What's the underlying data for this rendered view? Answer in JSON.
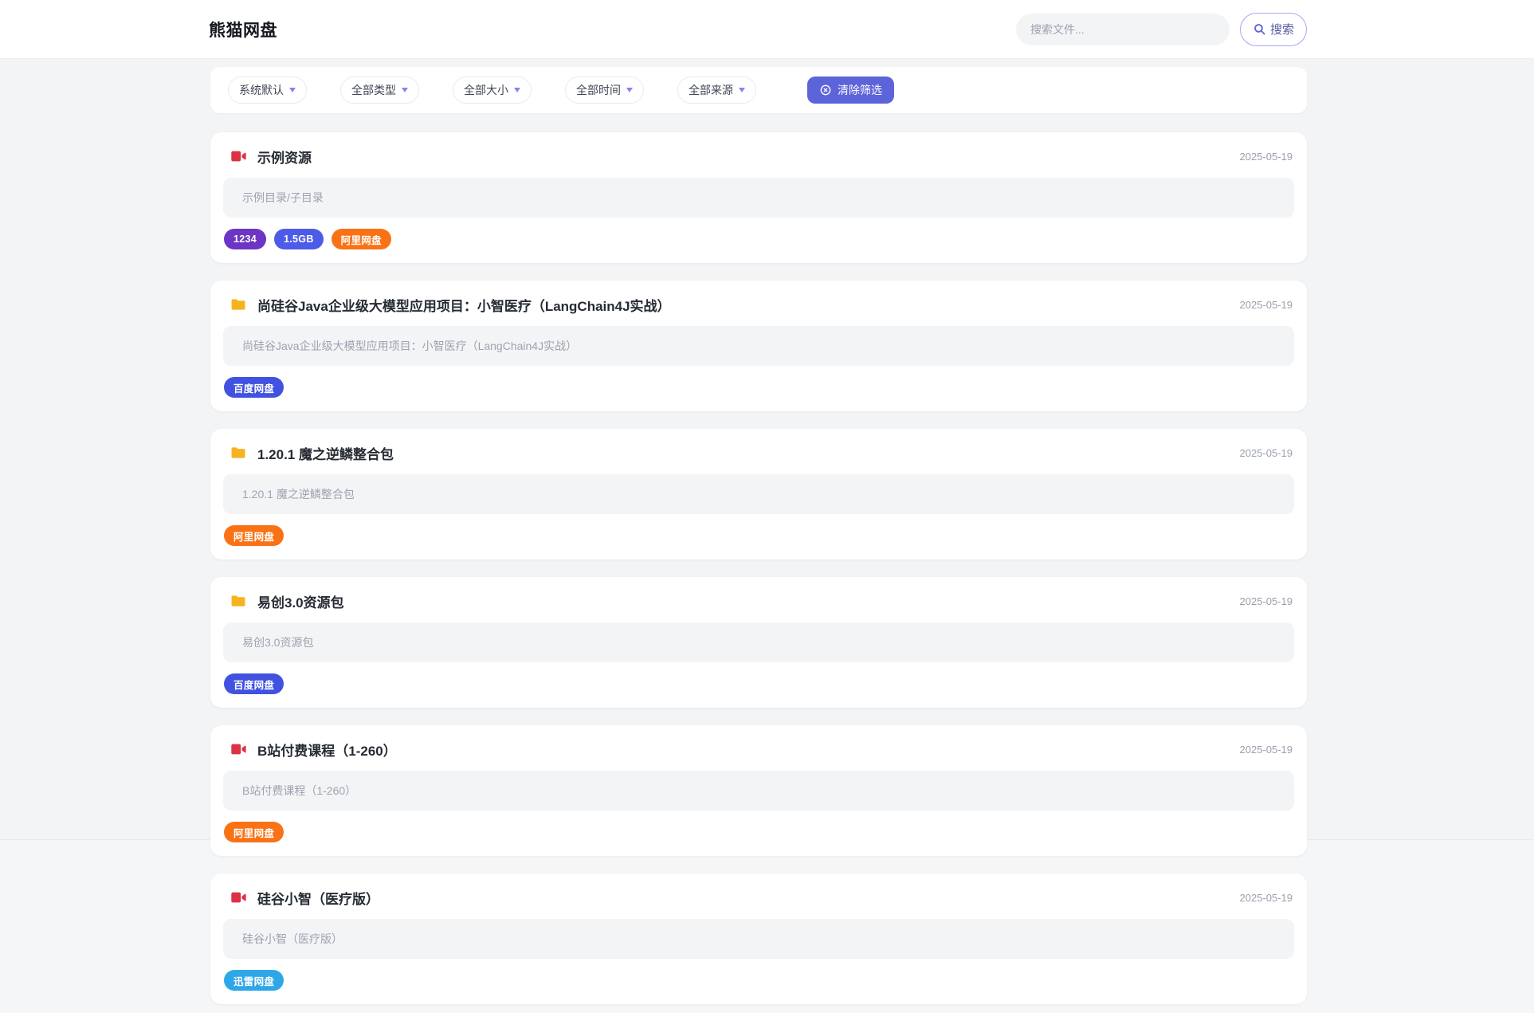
{
  "header": {
    "site_title": "熊猫网盘",
    "search": {
      "placeholder": "搜索文件...",
      "button_label": "搜索",
      "icon": "search-icon"
    }
  },
  "filters": {
    "dropdowns": [
      {
        "label": "系统默认",
        "icon": "chevron-down-icon"
      },
      {
        "label": "全部类型",
        "icon": "chevron-down-icon"
      },
      {
        "label": "全部大小",
        "icon": "chevron-down-icon"
      },
      {
        "label": "全部时间",
        "icon": "chevron-down-icon"
      },
      {
        "label": "全部来源",
        "icon": "chevron-down-icon"
      }
    ],
    "clear_button": {
      "label": "清除筛选",
      "icon": "circle-x-icon",
      "bg_color": "#5d63d9"
    }
  },
  "results": [
    {
      "icon": "video",
      "title": "示例资源",
      "date": "2025-05-19",
      "description": "示例目录/子目录",
      "tags": [
        {
          "label": "1234",
          "color": "#6d35c4"
        },
        {
          "label": "1.5GB",
          "color": "#4d5ce8"
        },
        {
          "label": "阿里网盘",
          "color": "#f97316"
        }
      ]
    },
    {
      "icon": "folder",
      "title": "尚硅谷Java企业级大模型应用项目：小智医疗（LangChain4J实战）",
      "date": "2025-05-19",
      "description": "尚硅谷Java企业级大模型应用项目：小智医疗（LangChain4J实战）",
      "tags": [
        {
          "label": "百度网盘",
          "color": "#4152e0"
        }
      ]
    },
    {
      "icon": "folder",
      "title": "1.20.1 魔之逆鳞整合包",
      "date": "2025-05-19",
      "description": "1.20.1 魔之逆鳞整合包",
      "tags": [
        {
          "label": "阿里网盘",
          "color": "#f97316"
        }
      ]
    },
    {
      "icon": "folder",
      "title": "易创3.0资源包",
      "date": "2025-05-19",
      "description": "易创3.0资源包",
      "tags": [
        {
          "label": "百度网盘",
          "color": "#4152e0"
        }
      ]
    },
    {
      "icon": "video",
      "title": "B站付费课程（1-260）",
      "date": "2025-05-19",
      "description": "B站付费课程（1-260）",
      "tags": [
        {
          "label": "阿里网盘",
          "color": "#f97316"
        }
      ]
    },
    {
      "icon": "video",
      "title": "硅谷小智（医疗版）",
      "date": "2025-05-19",
      "description": "硅谷小智（医疗版）",
      "tags": [
        {
          "label": "迅雷网盘",
          "color": "#2ea7e8"
        }
      ]
    }
  ],
  "colors": {
    "page_bg": "#f2f4f6",
    "card_bg": "#ffffff",
    "desc_box_bg": "#f3f4f6",
    "video_icon": "#dc3246",
    "folder_icon": "#f5b41f",
    "accent_indigo": "#5d63d9"
  }
}
